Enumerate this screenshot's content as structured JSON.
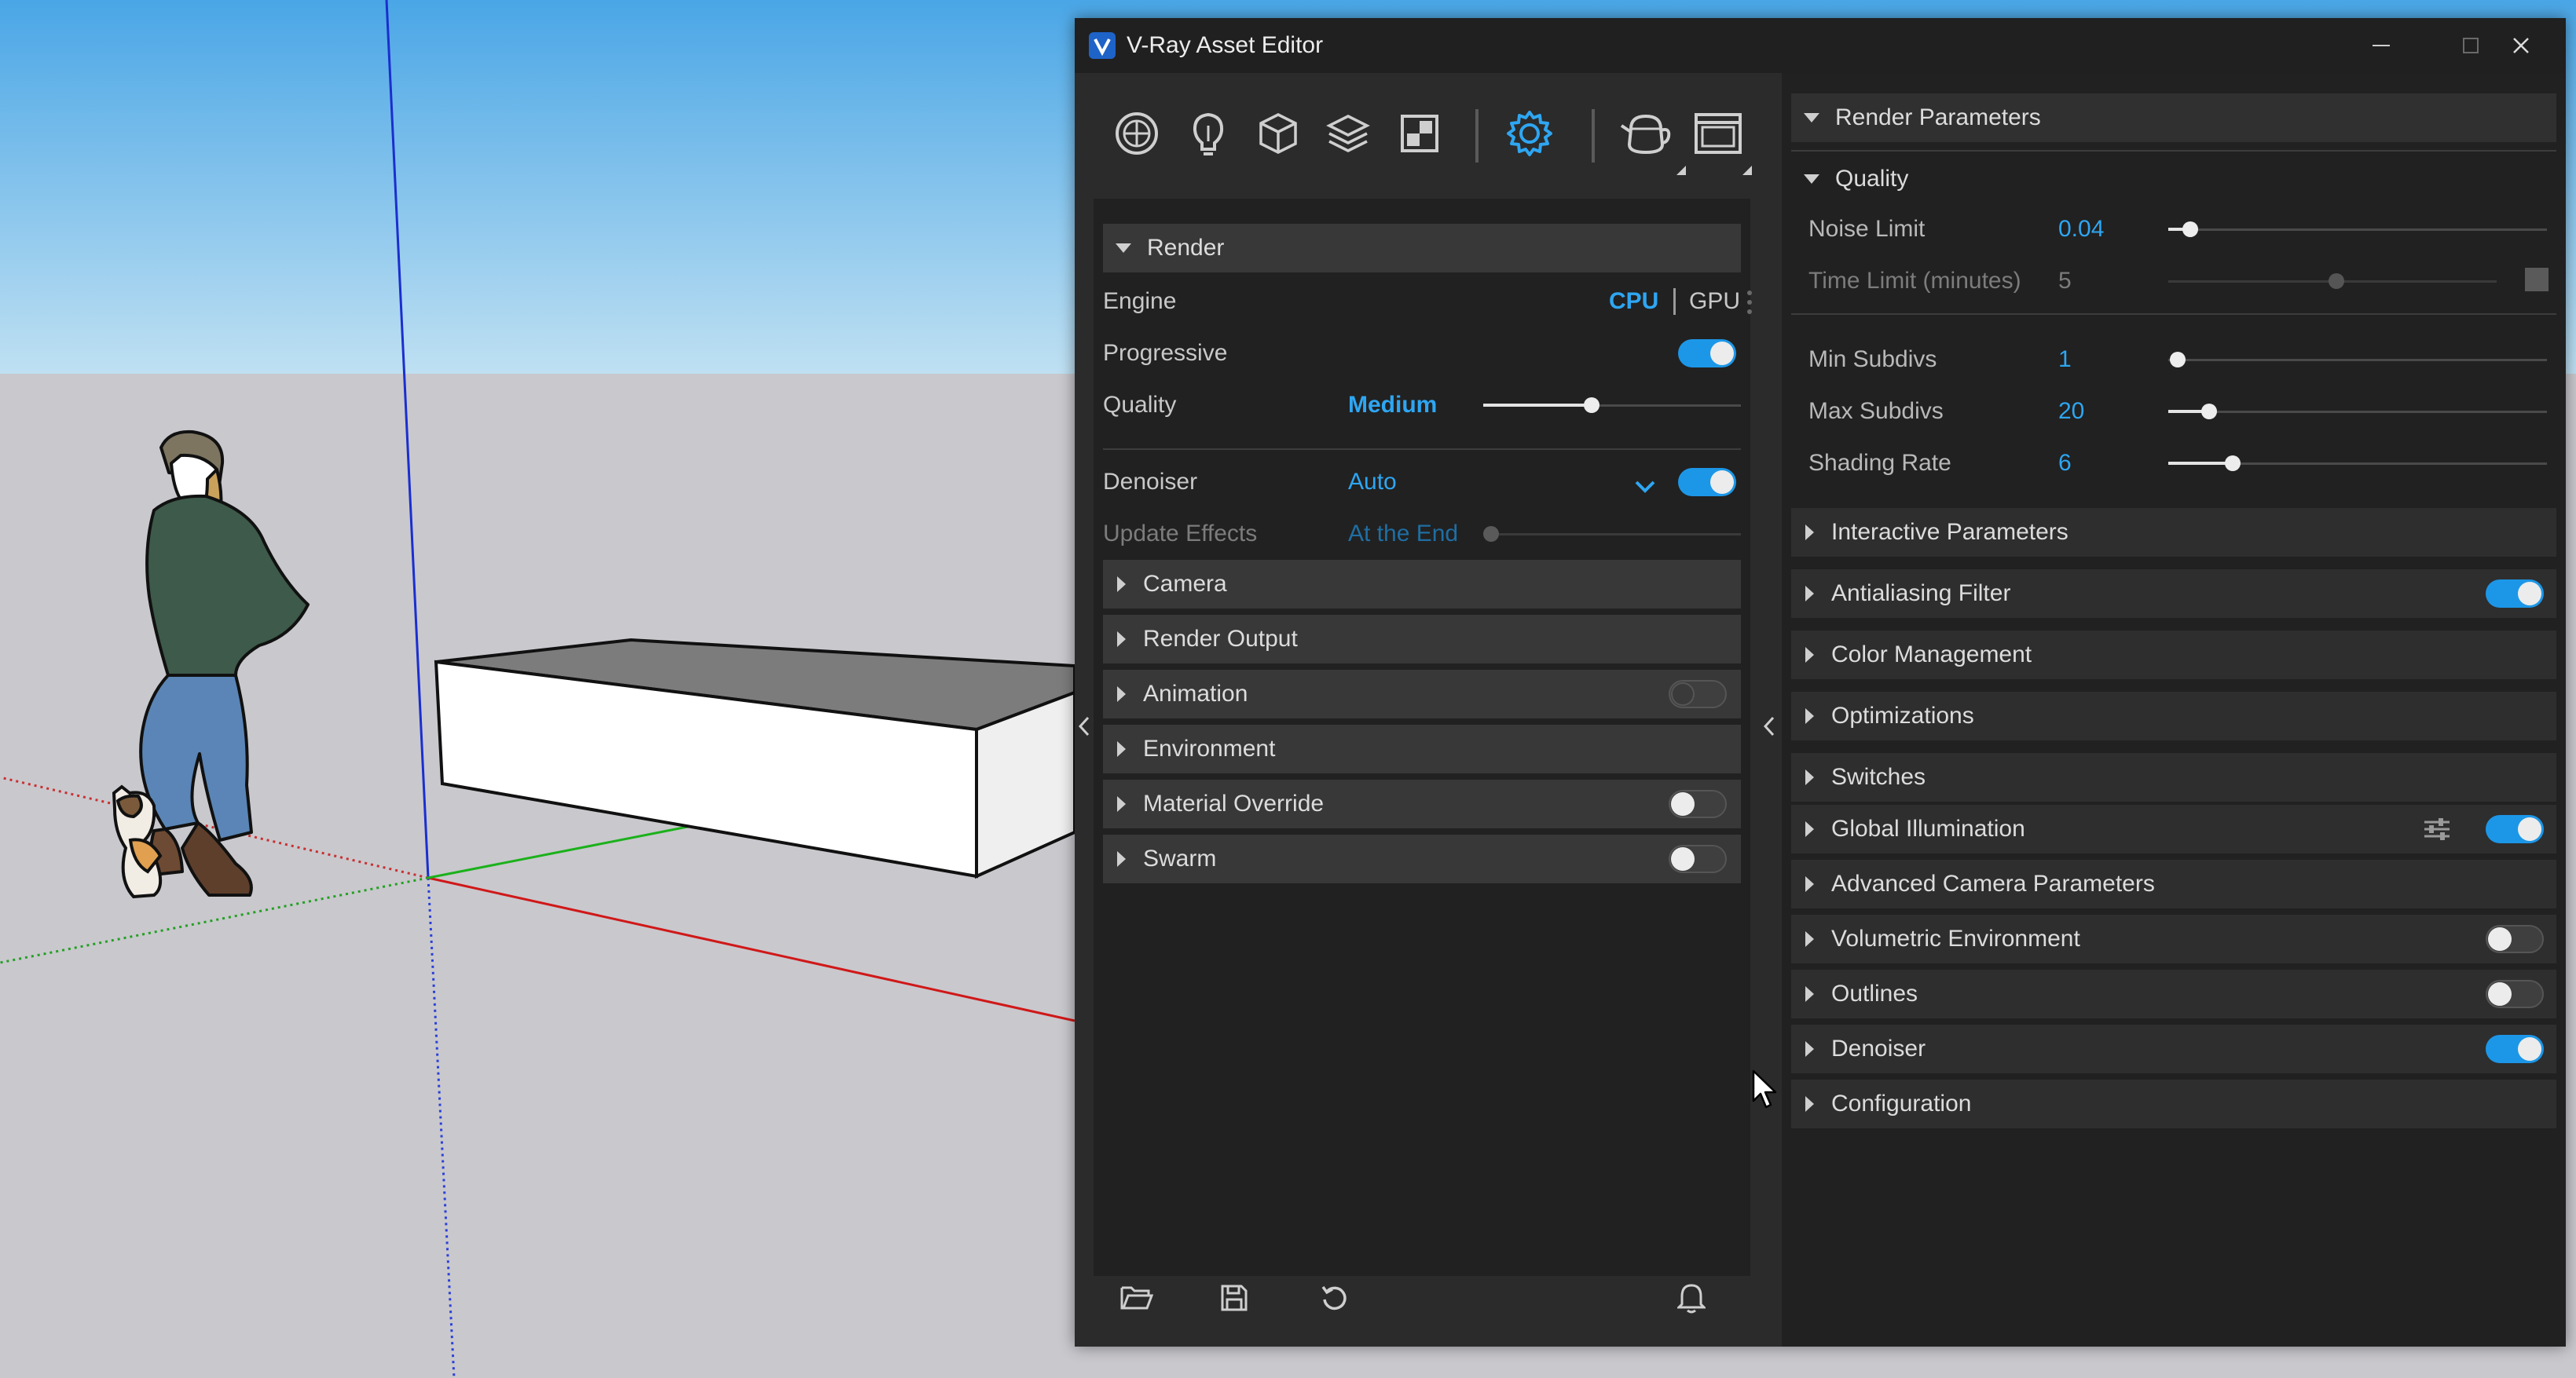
{
  "window": {
    "title": "V-Ray Asset Editor",
    "controls": [
      "minimize",
      "maximize",
      "close"
    ]
  },
  "toolbar": {
    "icons": [
      "materials-icon",
      "lights-icon",
      "geometry-icon",
      "layers-icon",
      "textures-icon",
      "settings-icon",
      "render-teapot-icon",
      "frame-buffer-icon"
    ],
    "active": "settings-icon",
    "accent": "#2ea6f2"
  },
  "render": {
    "header": "Render",
    "engine": {
      "label": "Engine",
      "cpu": "CPU",
      "gpu": "GPU",
      "selected": "CPU"
    },
    "progressive": {
      "label": "Progressive",
      "on": true
    },
    "quality": {
      "label": "Quality",
      "value": "Medium",
      "level": 0.55
    },
    "denoiser": {
      "label": "Denoiser",
      "value": "Auto",
      "on": true
    },
    "update_effects": {
      "label": "Update Effects",
      "value": "At the End"
    }
  },
  "left_sections": [
    {
      "label": "Camera"
    },
    {
      "label": "Render Output"
    },
    {
      "label": "Animation",
      "toggle": false
    },
    {
      "label": "Environment"
    },
    {
      "label": "Material Override",
      "toggle": false
    },
    {
      "label": "Swarm",
      "toggle": false
    }
  ],
  "bottom_bar": [
    "open-folder-icon",
    "save-icon",
    "reset-icon",
    "notifications-icon"
  ],
  "render_parameters": {
    "header": "Render Parameters",
    "quality": {
      "header": "Quality",
      "noise_limit": {
        "label": "Noise Limit",
        "value": "0.04",
        "level": 0.06
      },
      "time_limit": {
        "label": "Time Limit (minutes)",
        "value": "5",
        "level": 0.49,
        "enabled": false
      },
      "min_subdivs": {
        "label": "Min Subdivs",
        "value": "1",
        "level": 0.02
      },
      "max_subdivs": {
        "label": "Max Subdivs",
        "value": "20",
        "level": 0.11
      },
      "shading_rate": {
        "label": "Shading Rate",
        "value": "6",
        "level": 0.17
      }
    },
    "sections": [
      {
        "label": "Interactive Parameters"
      },
      {
        "label": "Antialiasing Filter",
        "toggle": true
      },
      {
        "label": "Color Management"
      },
      {
        "label": "Optimizations"
      },
      {
        "label": "Switches"
      },
      {
        "label": "Global Illumination",
        "toggle": true,
        "extra_icon": "sliders-icon"
      },
      {
        "label": "Advanced Camera Parameters"
      },
      {
        "label": "Volumetric Environment",
        "toggle": false
      },
      {
        "label": "Outlines",
        "toggle": false
      },
      {
        "label": "Denoiser",
        "toggle": true
      },
      {
        "label": "Configuration"
      }
    ]
  }
}
